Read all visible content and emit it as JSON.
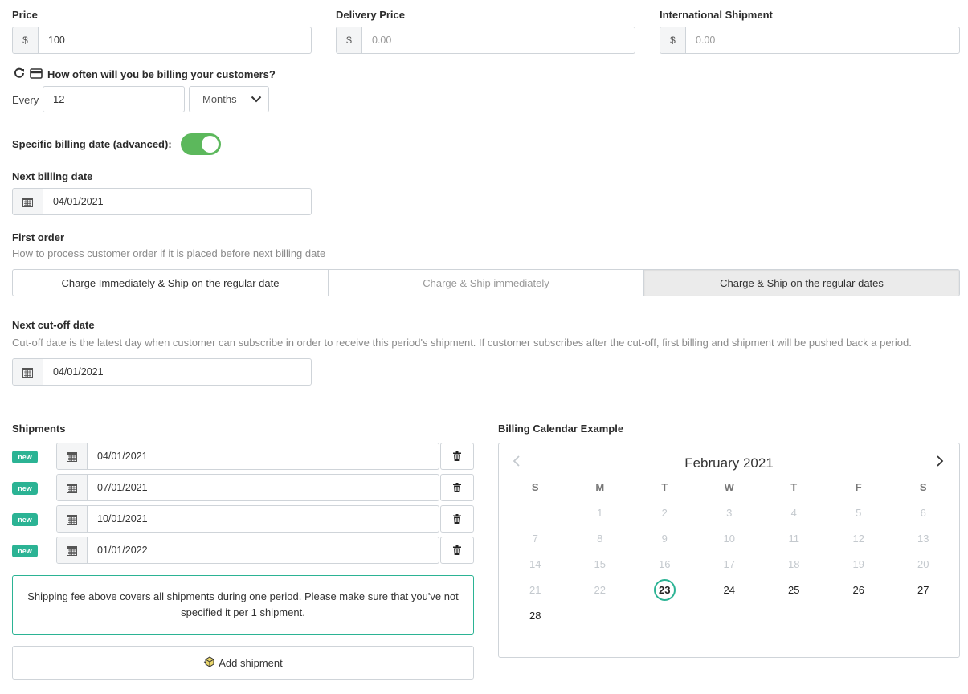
{
  "price": {
    "label": "Price",
    "currency": "$",
    "value": "100"
  },
  "delivery_price": {
    "label": "Delivery Price",
    "currency": "$",
    "placeholder": "0.00"
  },
  "international": {
    "label": "International Shipment",
    "currency": "$",
    "placeholder": "0.00"
  },
  "billing_frequency": {
    "question": "How often will you be billing your customers?",
    "every_label": "Every",
    "interval_value": "12",
    "unit_selected": "Months",
    "icons": [
      "refresh-icon",
      "credit-card-icon"
    ]
  },
  "specific_date": {
    "label": "Specific billing date (advanced):",
    "enabled": true,
    "color": "#5cb85c"
  },
  "next_billing": {
    "label": "Next billing date",
    "value": "04/01/2021"
  },
  "first_order": {
    "label": "First order",
    "hint": "How to process customer order if it is placed before next billing date",
    "options": [
      "Charge Immediately & Ship on the regular date",
      "Charge & Ship immediately",
      "Charge & Ship on the regular dates"
    ],
    "selected_index": 2
  },
  "cutoff": {
    "label": "Next cut-off date",
    "hint": "Cut-off date is the latest day when customer can subscribe in order to receive this period's shipment. If customer subscribes after the cut-off, first billing and shipment will be pushed back a period.",
    "value": "04/01/2021"
  },
  "shipments": {
    "label": "Shipments",
    "badge": "new",
    "dates": [
      "04/01/2021",
      "07/01/2021",
      "10/01/2021",
      "01/01/2022"
    ],
    "note": "Shipping fee above covers all shipments during one period. Please make sure that you've not specified it per 1 shipment.",
    "add_label": "Add shipment"
  },
  "calendar": {
    "label": "Billing Calendar Example",
    "month": "February 2021",
    "weekdays": [
      "S",
      "M",
      "T",
      "W",
      "T",
      "F",
      "S"
    ],
    "weeks": [
      [
        "",
        "1",
        "2",
        "3",
        "4",
        "5",
        "6"
      ],
      [
        "7",
        "8",
        "9",
        "10",
        "11",
        "12",
        "13"
      ],
      [
        "14",
        "15",
        "16",
        "17",
        "18",
        "19",
        "20"
      ],
      [
        "21",
        "22",
        "23",
        "24",
        "25",
        "26",
        "27"
      ],
      [
        "28",
        "",
        "",
        "",
        "",
        "",
        ""
      ]
    ],
    "highlight": "23",
    "first_active": 23,
    "accent": "#2bb394"
  }
}
